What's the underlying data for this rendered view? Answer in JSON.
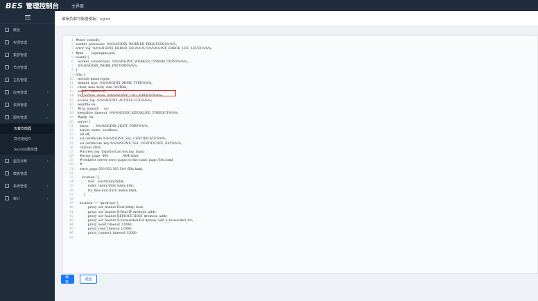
{
  "app": {
    "logo": "BES",
    "title": "管理控制台",
    "nav_link": "主界面"
  },
  "sidebar": {
    "items": [
      {
        "label": "概览",
        "has_children": false
      },
      {
        "label": "实例管理",
        "has_children": false
      },
      {
        "label": "集群管理",
        "has_children": false
      },
      {
        "label": "节点管理",
        "has_children": false
      },
      {
        "label": "主机管理",
        "has_children": false
      },
      {
        "label": "应用管理",
        "has_children": true
      },
      {
        "label": "资源管理",
        "has_children": true
      },
      {
        "label": "服务管理",
        "has_children": true,
        "expanded": true
      }
    ],
    "sub_items": [
      {
        "label": "负载均衡器",
        "active": true
      },
      {
        "label": "高可用组件",
        "active": false
      },
      {
        "label": "Session服务器",
        "active": false
      }
    ],
    "items_after": [
      {
        "label": "监控诊断",
        "has_children": true
      },
      {
        "label": "模板管理",
        "has_children": false
      },
      {
        "label": "系统管理",
        "has_children": true
      },
      {
        "label": "审计",
        "has_children": true
      }
    ]
  },
  "page": {
    "header": "编辑负载均衡器模板：nginx"
  },
  "editor": {
    "lines": [
      "#user  nobody;",
      "worker_processes  %%%NGINX_WORKER_PROCESSES%%%;",
      "error_log  %%%NGINX_ERROR_LOG%%% %%%NGINX_ERROR_LOG_LEVEL%%%;",
      "#pid        logs/nginx.pid;",
      "events {",
      "  worker_connections  %%%NGINX_WORKER_CONNECTIONS%%%;",
      "  %%%NGINX_WORK_PATTERN%%%",
      "}",
      "http {",
      "  include mime.types;",
      "  default_type  %%%NGINX_MIME_TYPE%%%;",
      "  client_max_body_size 10240m;",
      "  server_tokens off;",
      "  log_format  main  %%%NGINX_LOG_FORMAT%%%;",
      "  access_log  %%%NGINX_ACCESS_LOG%%%;",
      "  sendfile on;",
      "  #tcp_nopush     on;",
      "  keepalive_timeout  %%%NGINX_KEEPALIVE_TIMEOUT%%%;",
      "  #gzip  on;",
      "  server {",
      "    listen       %%%NGINX_HOST_PORT%%%;",
      "    server_name  localhost;",
      "    ssl off;",
      "    ssl_certificate %%%NGINX_SSL_CERTIFICATE%%%;",
      "    ssl_certificate_key %%%NGINX_SSL_CERTIFICATE_KEY%%%;",
      "    charset utf-8;",
      "    #access_log  logs/host.access.log  main;",
      "    #error_page  404              /404.html;",
      "    # redirect server error pages to the static page /50x.html",
      "    #",
      "    error_page 500 502 503 504 /50x.html;",
      "",
      "      location / {",
      "            root   /usr/trinity/html;",
      "            index  index.html index.htm;",
      "            try_files $uri $uri/ /index.html;",
      "        }",
      "",
      "    location ^~ /prod-api/ {",
      "            proxy_set_header Host $http_host;",
      "            proxy_set_header X-Real-IP $remote_addr;",
      "            proxy_set_header REMOTE-HOST $remote_addr;",
      "            proxy_set_header X-Forwarded-For $proxy_add_x_forwarded_for;",
      "            proxy_send_timeout 12000;",
      "            proxy_read_timeout 12000;",
      "            proxy_connect_timeout 12000;",
      ""
    ]
  },
  "buttons": {
    "save": "保存",
    "back": "返回"
  },
  "colors": {
    "sidebar_bg": "#1f2d3d",
    "primary": "#1677ff",
    "highlight": "#e02b2b"
  }
}
